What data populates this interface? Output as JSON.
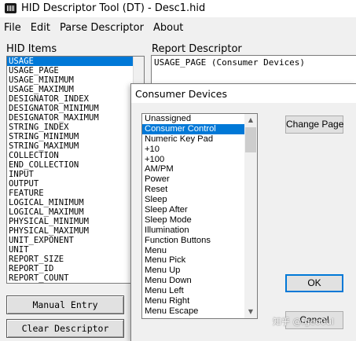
{
  "window": {
    "title": "HID Descriptor Tool (DT) - Desc1.hid"
  },
  "menu": [
    "File",
    "Edit",
    "Parse Descriptor",
    "About"
  ],
  "hid_items": {
    "label": "HID Items",
    "selected_index": 0,
    "items": [
      "USAGE",
      "USAGE_PAGE",
      "USAGE_MINIMUM",
      "USAGE_MAXIMUM",
      "DESIGNATOR_INDEX",
      "DESIGNATOR_MINIMUM",
      "DESIGNATOR_MAXIMUM",
      "STRING_INDEX",
      "STRING_MINIMUM",
      "STRING_MAXIMUM",
      "COLLECTION",
      "END_COLLECTION",
      "INPUT",
      "OUTPUT",
      "FEATURE",
      "LOGICAL_MINIMUM",
      "LOGICAL_MAXIMUM",
      "PHYSICAL_MINIMUM",
      "PHYSICAL_MAXIMUM",
      "UNIT_EXPONENT",
      "UNIT",
      "REPORT_SIZE",
      "REPORT_ID",
      "REPORT_COUNT"
    ]
  },
  "report_descriptor": {
    "label": "Report Descriptor",
    "lines": [
      "USAGE_PAGE (Consumer Devices)"
    ]
  },
  "buttons": {
    "manual_entry": "Manual Entry",
    "clear_descriptor": "Clear Descriptor"
  },
  "dialog": {
    "title": "Consumer Devices",
    "selected_index": 1,
    "usages": [
      "Unassigned",
      "Consumer Control",
      "Numeric Key Pad",
      "+10",
      "+100",
      "AM/PM",
      "Power",
      "Reset",
      "Sleep",
      "Sleep After",
      "Sleep Mode",
      "Illumination",
      "Function Buttons",
      "Menu",
      "Menu  Pick",
      "Menu Up",
      "Menu Down",
      "Menu Left",
      "Menu Right",
      "Menu Escape"
    ],
    "change_page": "Change Page",
    "ok": "OK",
    "cancel": "Cancel"
  },
  "watermark": "知乎 @fgeo0ul"
}
